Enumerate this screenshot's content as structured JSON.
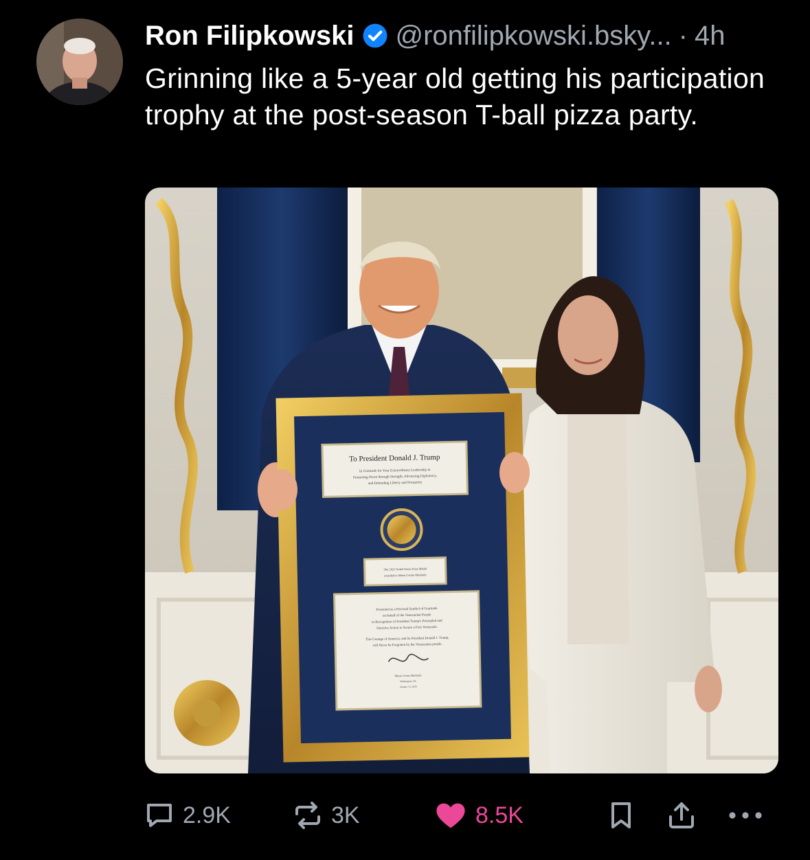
{
  "post": {
    "author": {
      "display_name": "Ron Filipkowski",
      "handle": "@ronfilipkowski.bsky...",
      "verified": true,
      "verified_icon": "verified-check-icon"
    },
    "separator": "·",
    "age": "4h",
    "text": "Grinning like a 5-year old getting his participation trophy at the post-season T-ball pizza party.",
    "image": {
      "plaque_top": {
        "title": "To President Donald J. Trump",
        "line1": "In Gratitude for Your Extraordinary Leadership in",
        "line2": "Promoting Peace through Strength, Advancing Diplomacy,",
        "line3": "and Defending Liberty and Prosperity"
      },
      "plaque_middle": {
        "line1": "The 2025 Nobel Peace Prize Medal",
        "line2": "awarded to Maria Corina Machado"
      },
      "plaque_bottom": {
        "line1": "Presented as a Personal Symbol of Gratitude",
        "line2": "on behalf of the Venezuelan People",
        "line3": "in Recognition of President Trump's Principled and",
        "line4": "Decisive Action to Secure a Free Venezuela.",
        "line5": "The Courage of America, and its President Donald J. Trump,",
        "line6": "will Never be Forgotten by the Venezuelan people.",
        "name": "Maria Corina Machado",
        "place": "Washington, DC",
        "date": "January 15, 2026"
      }
    },
    "actions": {
      "reply": {
        "icon": "reply-bubble-icon",
        "count": "2.9K"
      },
      "repost": {
        "icon": "repost-arrows-icon",
        "count": "3K"
      },
      "like": {
        "icon": "heart-filled-icon",
        "count": "8.5K",
        "color": "#ec4899"
      },
      "bookmark": {
        "icon": "bookmark-icon"
      },
      "share": {
        "icon": "share-upload-icon"
      },
      "more": {
        "icon": "more-dots-icon"
      }
    }
  },
  "colors": {
    "background": "#000000",
    "text": "#ffffff",
    "muted": "#a0a8b2",
    "verified": "#1083fe",
    "like": "#ec4899"
  }
}
